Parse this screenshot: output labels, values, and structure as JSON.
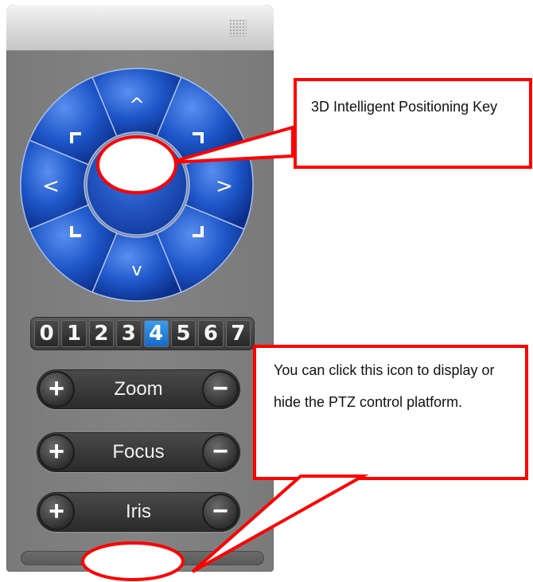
{
  "dpad": {
    "up_glyph": "^",
    "down_glyph": "v",
    "left_glyph": "<",
    "right_glyph": ">",
    "color_main": "#1e56c8"
  },
  "presets": {
    "labels": [
      "0",
      "1",
      "2",
      "3",
      "4",
      "5",
      "6",
      "7"
    ],
    "selected": "4"
  },
  "controls": [
    {
      "label": "Zoom",
      "plus": "+",
      "minus": "−"
    },
    {
      "label": "Focus",
      "plus": "+",
      "minus": "−"
    },
    {
      "label": "Iris",
      "plus": "+",
      "minus": "−"
    }
  ],
  "annotations": {
    "positioning_key": "3D Intelligent Positioning Key",
    "toggle_tip": "You can click this icon to display or hide the PTZ control platform.",
    "callout_color": "#ff0000"
  }
}
